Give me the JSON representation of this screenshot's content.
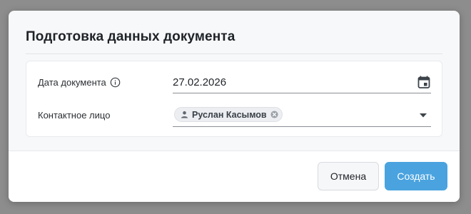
{
  "dialog": {
    "title": "Подготовка данных документа"
  },
  "form": {
    "date": {
      "label": "Дата документа",
      "value": "27.02.2026",
      "info_icon": "info-icon",
      "picker_icon": "calendar-icon"
    },
    "contact": {
      "label": "Контактное лицо",
      "selected_chip": "Руслан Касымов",
      "chip_icon": "person-icon",
      "remove_icon": "close-circle-icon",
      "dropdown_icon": "dropdown-arrow-icon"
    }
  },
  "footer": {
    "cancel_label": "Отмена",
    "create_label": "Создать"
  },
  "colors": {
    "primary": "#4aa3df",
    "overlay": "#8d8d8d",
    "dialog_bg": "#f7f8fa"
  }
}
